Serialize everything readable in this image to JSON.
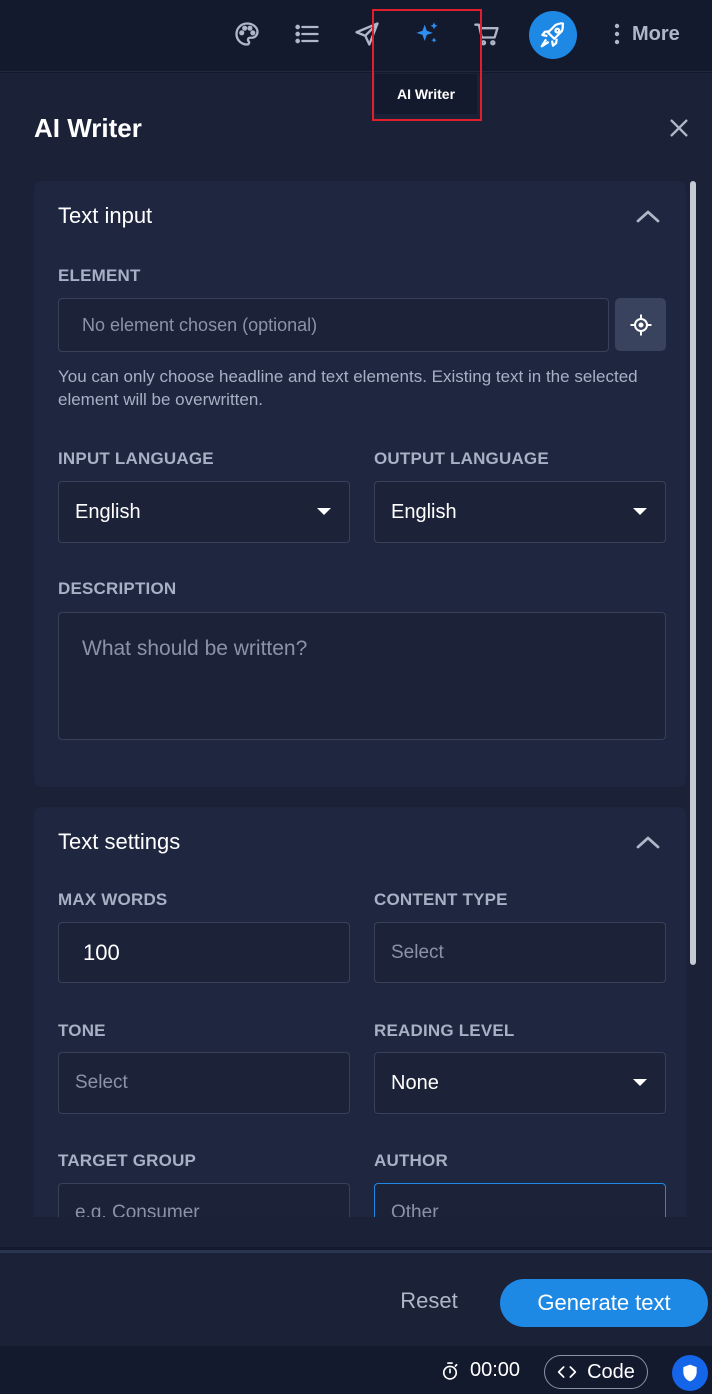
{
  "toolbar": {
    "icons": [
      "palette-icon",
      "list-icon",
      "send-icon",
      "ai-sparkle-icon",
      "cart-icon",
      "rocket-icon",
      "more-vert-icon"
    ],
    "more_label": "More",
    "tooltip": "AI Writer",
    "accent_color": "#1e88e5",
    "highlight_color": "#e01e2c"
  },
  "panel": {
    "title": "AI Writer",
    "text_input": {
      "title": "Text input",
      "element_label": "ELEMENT",
      "element_placeholder": "No element chosen (optional)",
      "hint": "You can only choose headline and text elements. Existing text in the selected element will be overwritten.",
      "input_language_label": "INPUT LANGUAGE",
      "input_language_value": "English",
      "output_language_label": "OUTPUT LANGUAGE",
      "output_language_value": "English",
      "description_label": "DESCRIPTION",
      "description_placeholder": "What should be written?"
    },
    "text_settings": {
      "title": "Text settings",
      "max_words_label": "MAX WORDS",
      "max_words_value": "100",
      "content_type_label": "CONTENT TYPE",
      "content_type_placeholder": "Select",
      "tone_label": "TONE",
      "tone_placeholder": "Select",
      "reading_level_label": "READING LEVEL",
      "reading_level_value": "None",
      "target_group_label": "TARGET GROUP",
      "target_group_placeholder": "e.g. Consumer",
      "author_label": "AUTHOR",
      "author_placeholder": "Other"
    }
  },
  "footer": {
    "reset_label": "Reset",
    "generate_label": "Generate text"
  },
  "statusbar": {
    "timer": "00:00",
    "code_label": "Code"
  }
}
